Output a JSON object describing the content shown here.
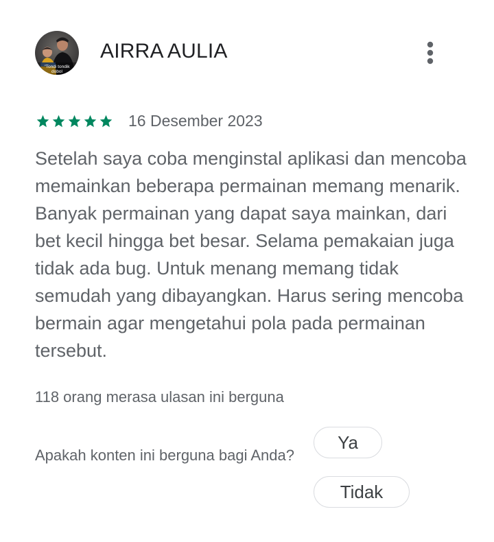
{
  "review": {
    "reviewer_name": "AIRRA AULIA",
    "avatar_caption": "Tondi tondik dobol",
    "rating": 5,
    "rating_max": 5,
    "star_color": "#01875f",
    "date": "16 Desember 2023",
    "text": "Setelah saya coba menginstal aplikasi dan mencoba memainkan beberapa permainan memang menarik. Banyak permainan yang dapat saya mainkan, dari bet kecil hingga bet besar. Selama pemakaian juga tidak ada bug. Untuk menang memang tidak semudah yang dibayangkan. Harus sering mencoba bermain agar mengetahui pola pada permainan tersebut.",
    "helpful_count_text": "118 orang merasa ulasan ini berguna"
  },
  "feedback": {
    "question": "Apakah konten ini berguna bagi Anda?",
    "yes_label": "Ya",
    "no_label": "Tidak"
  },
  "icons": {
    "more": "more-vert-icon",
    "star": "star-icon"
  }
}
